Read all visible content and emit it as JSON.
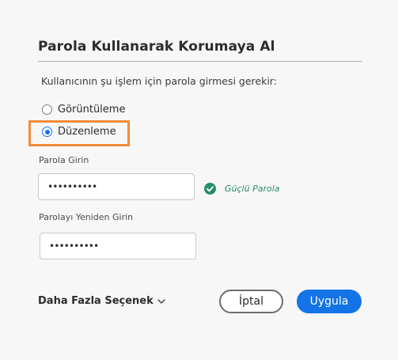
{
  "dialog": {
    "title": "Parola Kullanarak Korumaya Al",
    "prompt": "Kullanıcının şu işlem için parola girmesi gerekir:",
    "options": [
      {
        "label": "Görüntüleme",
        "selected": false
      },
      {
        "label": "Düzenleme",
        "selected": true
      }
    ],
    "password_label": "Parola Girin",
    "password_value": "••••••••••",
    "strength_label": "Güçlü Parola",
    "confirm_label": "Parolayı Yeniden Girin",
    "confirm_value": "••••••••••",
    "more_options_label": "Daha Fazla Seçenek",
    "cancel_label": "İptal",
    "apply_label": "Uygula"
  },
  "colors": {
    "accent": "#1473e6",
    "highlight": "#f28c38",
    "success": "#268e6c"
  },
  "icons": {
    "strength": "check-circle-icon",
    "more_options": "chevron-down-icon"
  }
}
